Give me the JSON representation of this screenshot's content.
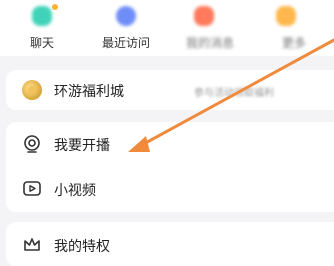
{
  "quick_actions": [
    {
      "label": "聊天",
      "icon": "chat-icon",
      "color": "#41d3b9",
      "has_dot": true
    },
    {
      "label": "最近访问",
      "icon": "recent-icon",
      "color": "#6f8df7",
      "has_dot": false
    },
    {
      "label": "我的消息",
      "icon": "message-icon",
      "color": "#ff7a5c",
      "has_dot": false
    },
    {
      "label": "更多",
      "icon": "more-icon",
      "color": "#ffb74d",
      "has_dot": false
    }
  ],
  "menu": {
    "welfare": {
      "label": "环游福利城",
      "right_text": "参与活动领取福利"
    },
    "live": {
      "label": "我要开播"
    },
    "video": {
      "label": "小视频"
    },
    "privilege": {
      "label": "我的特权"
    }
  },
  "colors": {
    "accent_arrow": "#f08a3c"
  }
}
